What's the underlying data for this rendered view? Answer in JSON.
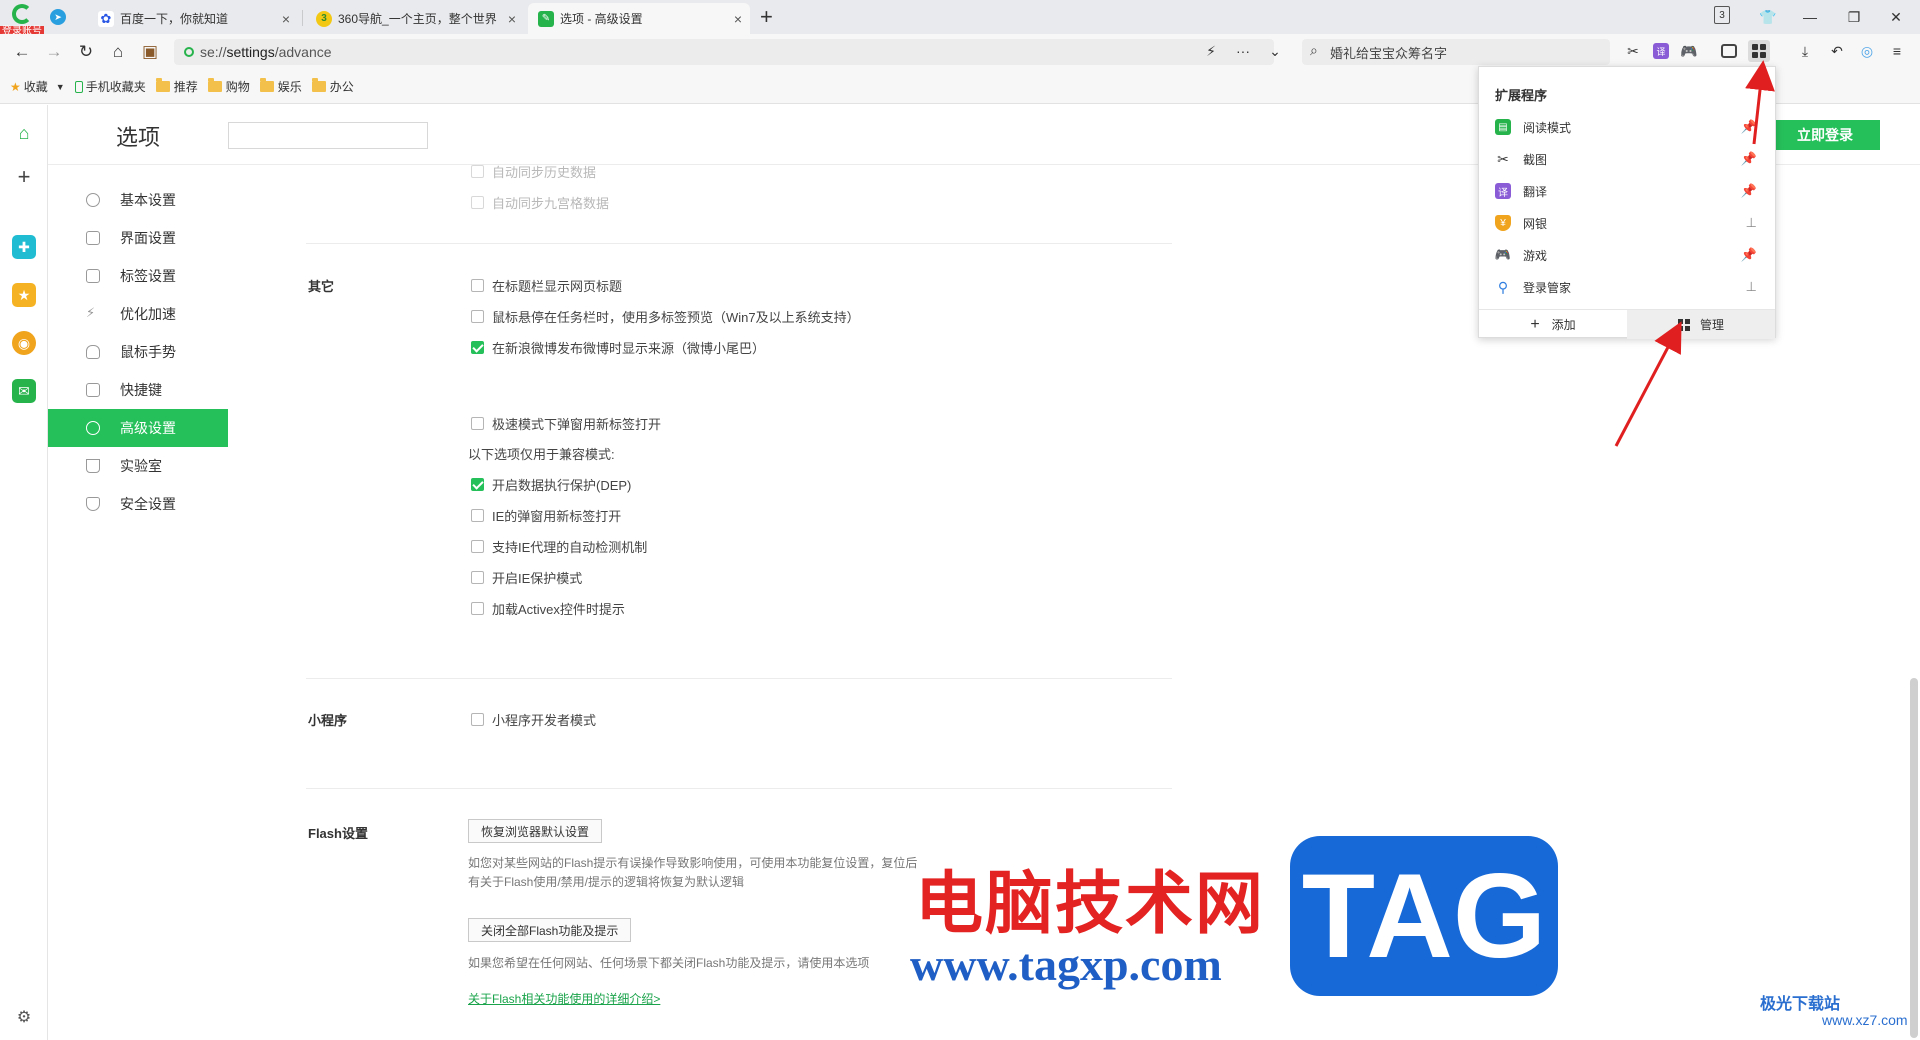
{
  "browser": {
    "badge": "登录账号",
    "tabs": [
      {
        "label": "百度一下，你就知道"
      },
      {
        "label": "360导航_一个主页，整个世界"
      },
      {
        "label": "选项 - 高级设置"
      }
    ],
    "new_tab": "+",
    "tab_count": "3",
    "address": {
      "prefix": "se://",
      "path": "settings",
      "suffix": "/advance"
    },
    "search_text": "婚礼给宝宝众筹名字",
    "bookmarks": [
      "收藏",
      "手机收藏夹",
      "推荐",
      "购物",
      "娱乐",
      "办公"
    ]
  },
  "page": {
    "title": "选项",
    "login_button": "立即登录"
  },
  "sidebar": {
    "items": [
      {
        "label": "基本设置",
        "icon": "gear-icon"
      },
      {
        "label": "界面设置",
        "icon": "window-icon"
      },
      {
        "label": "标签设置",
        "icon": "tab-icon"
      },
      {
        "label": "优化加速",
        "icon": "lightning-icon"
      },
      {
        "label": "鼠标手势",
        "icon": "mouse-icon"
      },
      {
        "label": "快捷键",
        "icon": "keyboard-icon"
      },
      {
        "label": "高级设置",
        "icon": "tool-icon",
        "active": true
      },
      {
        "label": "实验室",
        "icon": "flask-icon"
      },
      {
        "label": "安全设置",
        "icon": "shield-icon"
      }
    ]
  },
  "content": {
    "sync_options": [
      {
        "label": "自动同步历史数据",
        "checked": false
      },
      {
        "label": "自动同步九宫格数据",
        "checked": false
      }
    ],
    "other": {
      "label": "其它",
      "options": [
        {
          "label": "在标题栏显示网页标题",
          "checked": false
        },
        {
          "label": "鼠标悬停在任务栏时，使用多标签预览（Win7及以上系统支持）",
          "checked": false
        },
        {
          "label": "在新浪微博发布微博时显示来源（微博小尾巴）",
          "checked": true
        },
        {
          "label": "极速模式下弹窗用新标签打开",
          "checked": false
        }
      ],
      "compat_note": "以下选项仅用于兼容模式:",
      "compat_options": [
        {
          "label": "开启数据执行保护(DEP)",
          "checked": true
        },
        {
          "label": "IE的弹窗用新标签打开",
          "checked": false
        },
        {
          "label": "支持IE代理的自动检测机制",
          "checked": false
        },
        {
          "label": "开启IE保护模式",
          "checked": false
        },
        {
          "label": "加载Activex控件时提示",
          "checked": false
        }
      ]
    },
    "mini": {
      "label": "小程序",
      "options": [
        {
          "label": "小程序开发者模式",
          "checked": false
        }
      ]
    },
    "flash": {
      "label": "Flash设置",
      "restore_button": "恢复浏览器默认设置",
      "restore_desc_1": "如您对某些网站的Flash提示有误操作导致影响使用，可使用本功能复位设置，复位后",
      "restore_desc_2": "有关于Flash使用/禁用/提示的逻辑将恢复为默认逻辑",
      "disable_button": "关闭全部Flash功能及提示",
      "disable_desc": "如果您希望在任何网站、任何场景下都关闭Flash功能及提示，请使用本选项",
      "detail_link": "关于Flash相关功能使用的详细介绍>"
    }
  },
  "extensions_popup": {
    "title": "扩展程序",
    "items": [
      {
        "label": "阅读模式",
        "color": "#26b34c",
        "pinned": true
      },
      {
        "label": "截图",
        "color": "#333333",
        "pinned": true
      },
      {
        "label": "翻译",
        "color": "#8a5cd6",
        "pinned": true
      },
      {
        "label": "网银",
        "color": "#f0a31c",
        "pinned": false
      },
      {
        "label": "游戏",
        "color": "#f07a2a",
        "pinned": true
      },
      {
        "label": "登录管家",
        "color": "#2f7ee0",
        "pinned": false
      }
    ],
    "add_label": "添加",
    "manage_label": "管理"
  },
  "watermark": {
    "site_cn": "电脑技术网",
    "site_url": "www.tagxp.com",
    "tag": "TAG",
    "corner_brand": "极光下载站",
    "corner_url": "www.xz7.com"
  },
  "colors": {
    "accent": "#26c05b",
    "arrow": "#e02020",
    "tag_blue": "#1769d8"
  }
}
